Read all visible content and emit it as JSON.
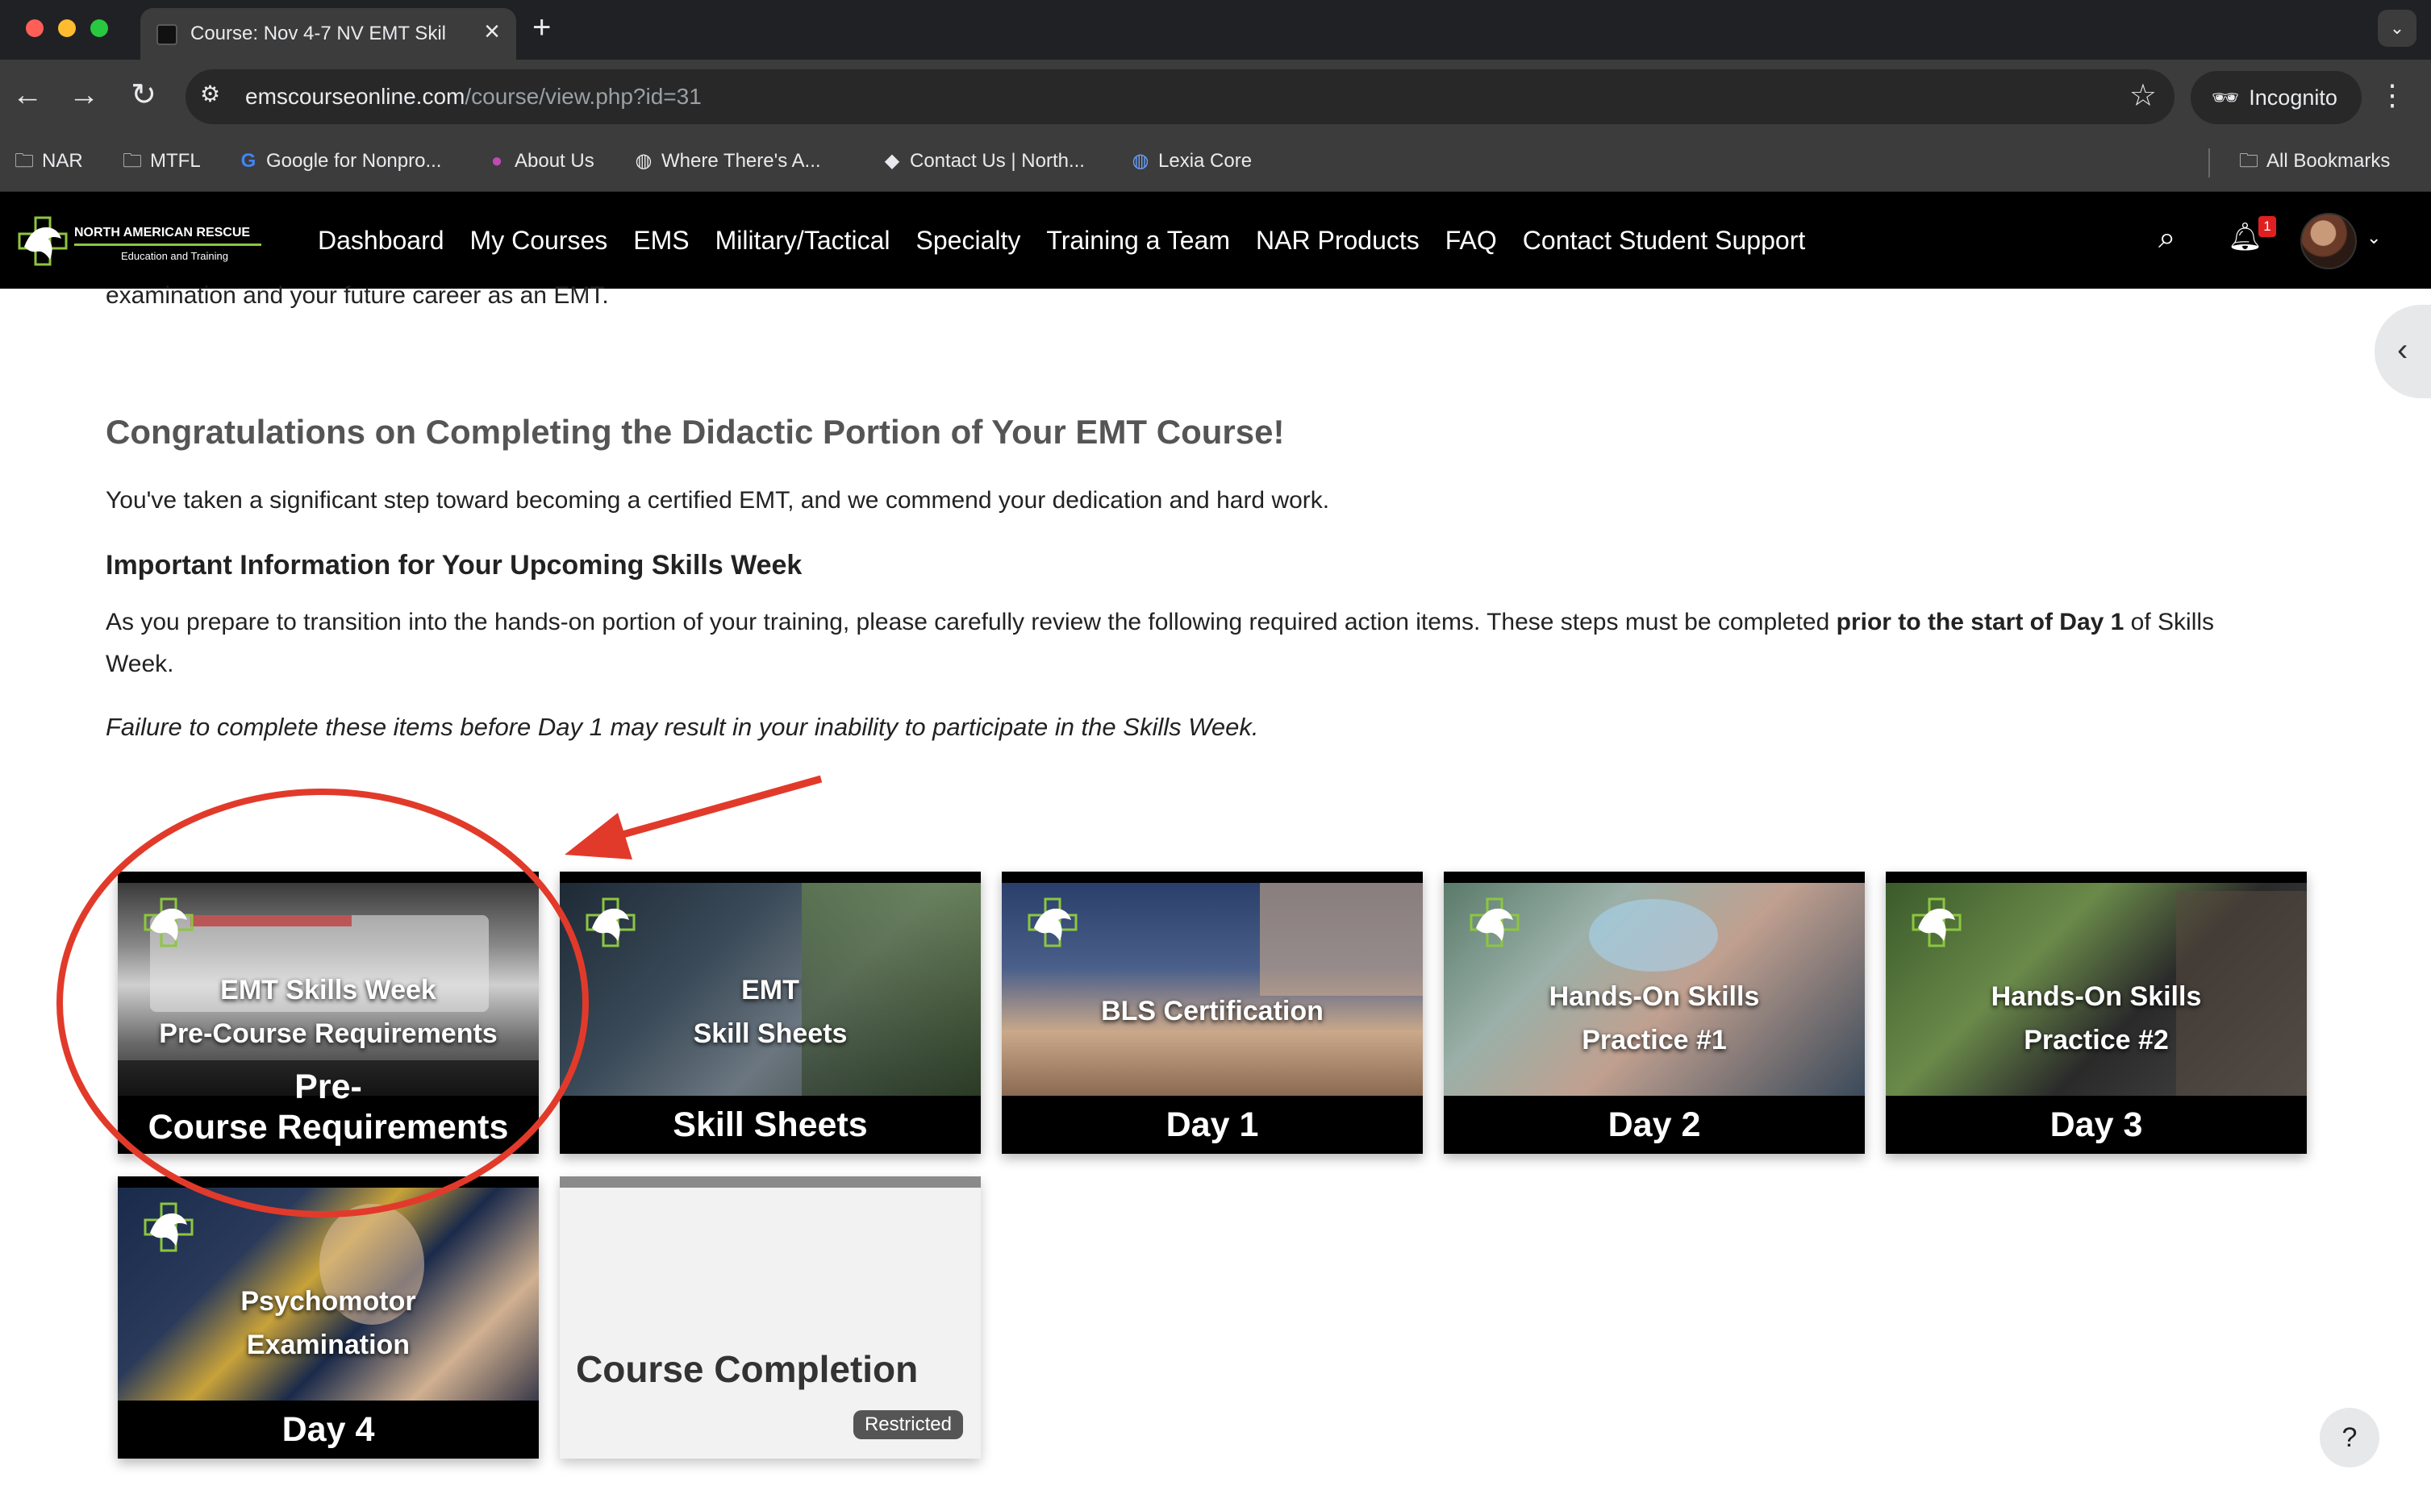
{
  "browser": {
    "tab_title": "Course: Nov 4-7 NV EMT Skil",
    "url_host": "emscourseonline.com",
    "url_path": "/course/view.php?id=31",
    "incognito_label": "Incognito",
    "bookmarks": [
      {
        "label": "NAR",
        "icon": "folder-icon"
      },
      {
        "label": "MTFL",
        "icon": "folder-icon"
      },
      {
        "label": "Google for Nonpro...",
        "icon": "google-icon"
      },
      {
        "label": "About Us",
        "icon": "site-icon"
      },
      {
        "label": "Where There's A...",
        "icon": "globe-icon"
      },
      {
        "label": "Contact Us | North...",
        "icon": "site-icon"
      },
      {
        "label": "Lexia Core",
        "icon": "globe-icon"
      }
    ],
    "all_bookmarks": "All Bookmarks"
  },
  "site": {
    "logo_title": "NORTH AMERICAN RESCUE",
    "logo_subtitle": "Education and Training",
    "nav": [
      "Dashboard",
      "My Courses",
      "EMS",
      "Military/Tactical",
      "Specialty",
      "Training a Team",
      "NAR Products",
      "FAQ",
      "Contact Student Support"
    ],
    "notification_count": "1"
  },
  "content": {
    "intro_tail": "examination and your future career as an EMT.",
    "congrats_heading": "Congratulations on Completing the Didactic Portion of Your EMT Course!",
    "step_text": "You've taken a significant step toward becoming a certified EMT, and we commend your dedication and hard work.",
    "important_heading": "Important Information for Your Upcoming Skills Week",
    "prepare_text": "As you prepare to transition into the hands-on portion of your training, please carefully review the following required action items. These steps must be completed ",
    "prepare_bold": "prior to the start of Day 1",
    "prepare_tail": " of Skills Week.",
    "failure_text": "Failure to complete these items before Day 1 may result in your inability to participate in the Skills Week."
  },
  "tiles": [
    {
      "overlay_line1": "EMT Skills Week",
      "overlay_line2": "Pre-Course Requirements",
      "footer_line1": "Pre-",
      "footer_line2": "Course Requirements"
    },
    {
      "overlay_line1": "EMT",
      "overlay_line2": "Skill Sheets",
      "footer": "Skill Sheets"
    },
    {
      "overlay_line1": "BLS Certification",
      "footer": "Day 1"
    },
    {
      "overlay_line1": "Hands-On Skills",
      "overlay_line2": "Practice #1",
      "footer": "Day 2"
    },
    {
      "overlay_line1": "Hands-On Skills",
      "overlay_line2": "Practice #2",
      "footer": "Day 3"
    },
    {
      "overlay_line1": "Psychomotor",
      "overlay_line2": "Examination",
      "footer": "Day 4"
    },
    {
      "title": "Course Completion",
      "badge": "Restricted"
    }
  ],
  "help_label": "?",
  "colors": {
    "annotation": "#e23a2a",
    "nav_bg": "#000000",
    "accent_green": "#8dc63f"
  }
}
